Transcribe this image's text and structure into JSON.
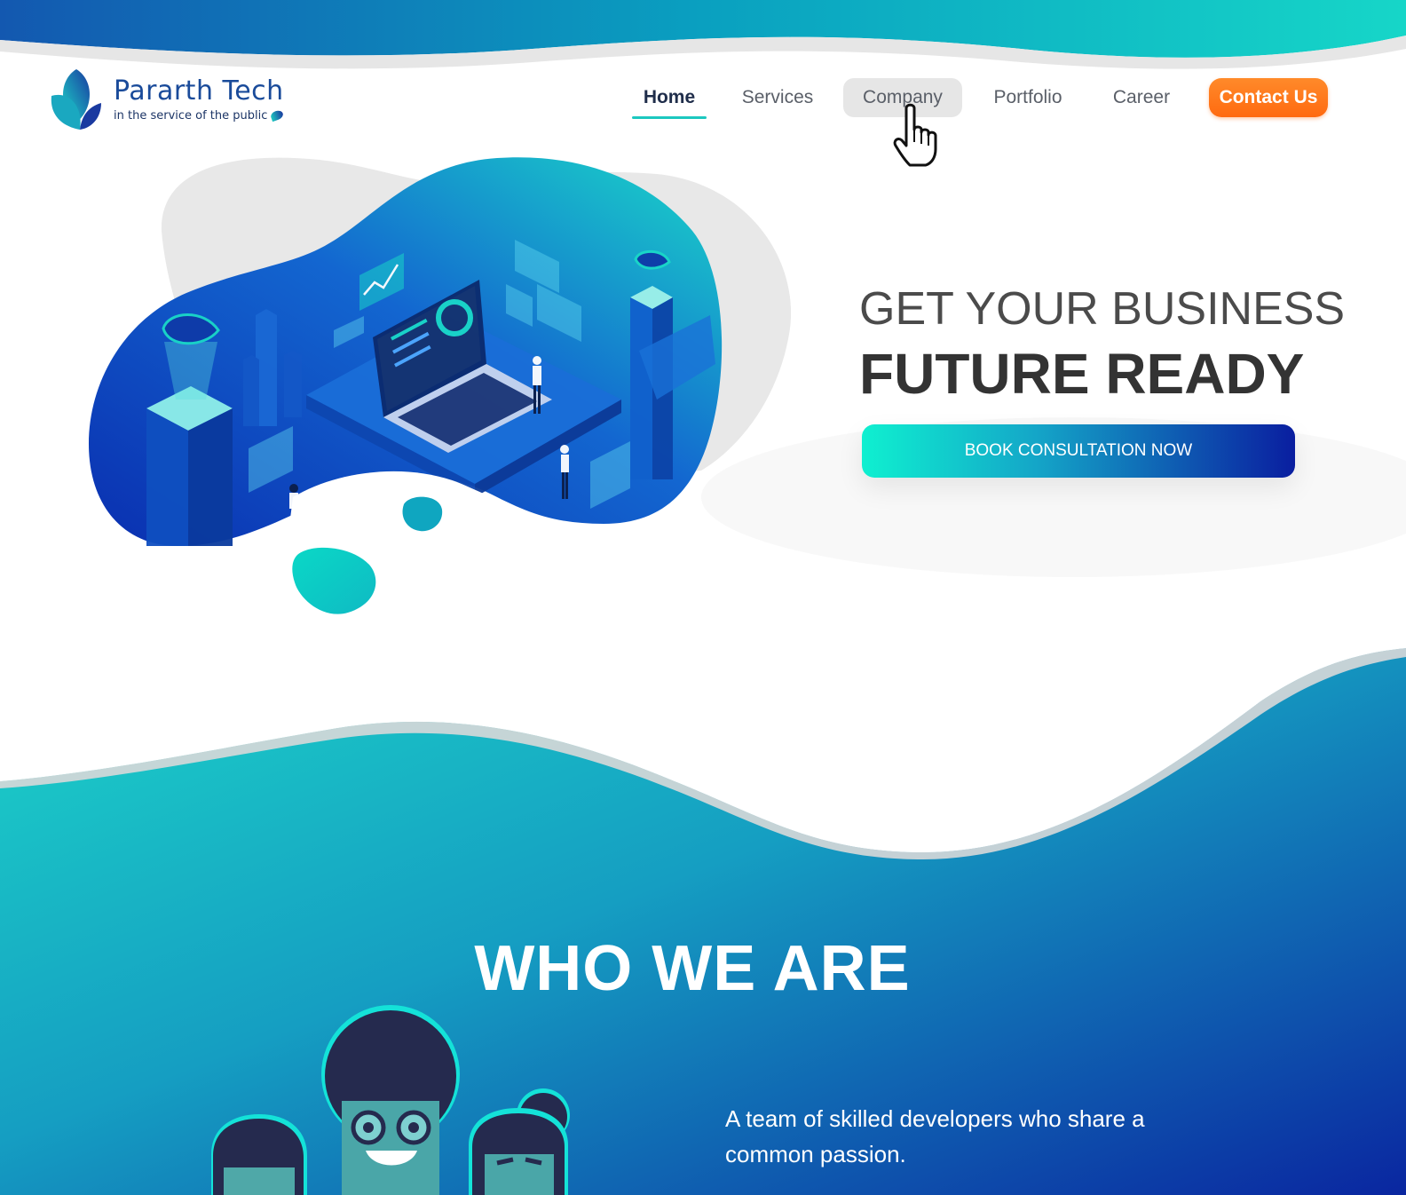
{
  "brand": {
    "name": "Pararth Tech",
    "tagline": "in the service of the public"
  },
  "nav": {
    "items": [
      {
        "label": "Home",
        "state": "active"
      },
      {
        "label": "Services",
        "state": "default"
      },
      {
        "label": "Company",
        "state": "hover"
      },
      {
        "label": "Portfolio",
        "state": "default"
      },
      {
        "label": "Career",
        "state": "default"
      }
    ],
    "contact_label": "Contact Us"
  },
  "hero": {
    "line1": "GET YOUR BUSINESS",
    "line2": "FUTURE READY",
    "cta_label": "BOOK CONSULTATION NOW"
  },
  "who": {
    "title": "WHO WE ARE",
    "description": "A team of skilled developers who share a common passion."
  },
  "colors": {
    "accent_teal": "#1cc8c0",
    "accent_blue": "#0a1ea0",
    "contact_orange": "#ff7a1a",
    "heading_dark": "#333333"
  },
  "icons": [
    "logo-leaf-icon",
    "pointer-hand-cursor-icon"
  ]
}
